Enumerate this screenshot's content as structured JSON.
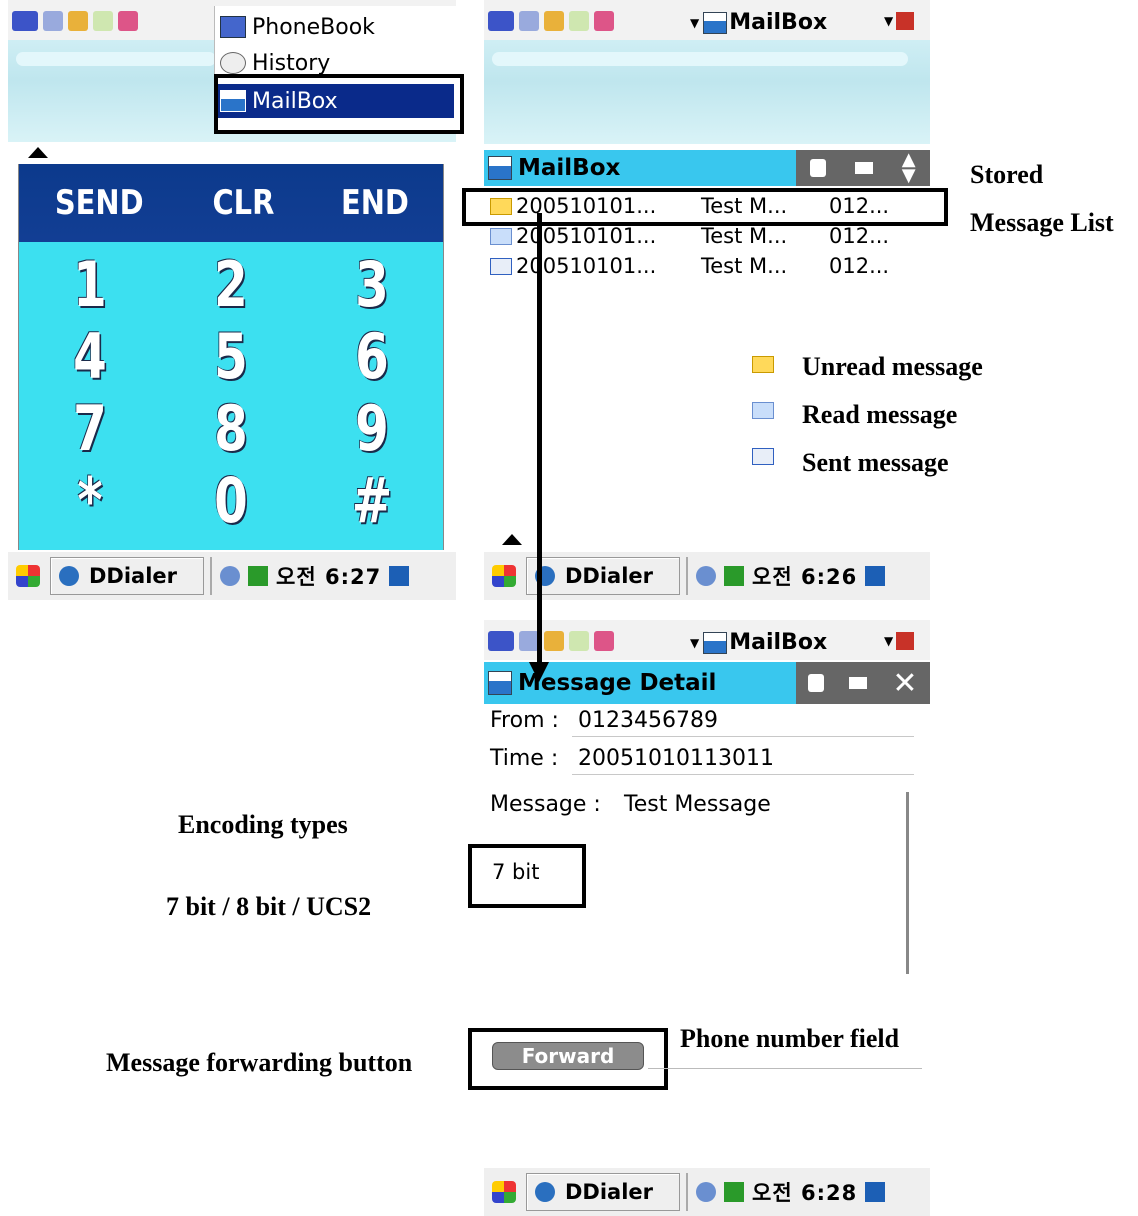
{
  "panel_left": {
    "menu": {
      "items": [
        {
          "label": "PhoneBook"
        },
        {
          "label": "History"
        },
        {
          "label": "MailBox"
        }
      ]
    },
    "keypad": {
      "top_keys": [
        "SEND",
        "CLR",
        "END"
      ],
      "rows": [
        [
          "1",
          "2",
          "3"
        ],
        [
          "4",
          "5",
          "6"
        ],
        [
          "7",
          "8",
          "9"
        ],
        [
          "*",
          "0",
          "#"
        ]
      ]
    },
    "taskbar": {
      "app": "DDialer",
      "time": "오전 6:27"
    }
  },
  "panel_mailbox": {
    "header": {
      "title": "MailBox"
    },
    "list_title": "MailBox",
    "messages": [
      {
        "type": "unread",
        "date": "200510101...",
        "text": "Test M...",
        "number": "012..."
      },
      {
        "type": "read",
        "date": "200510101...",
        "text": "Test M...",
        "number": "012..."
      },
      {
        "type": "sent",
        "date": "200510101...",
        "text": "Test M...",
        "number": "012..."
      }
    ],
    "taskbar": {
      "app": "DDialer",
      "time": "오전 6:26"
    }
  },
  "panel_detail": {
    "header": {
      "title": "MailBox"
    },
    "title": "Message Detail",
    "from_label": "From :",
    "from_value": "0123456789",
    "time_label": "Time :",
    "time_value": "20051010113011",
    "message_label": "Message :",
    "message_value": "Test Message",
    "encoding_value": "7 bit",
    "forward_label": "Forward",
    "taskbar": {
      "app": "DDialer",
      "time": "오전 6:28"
    }
  },
  "annotations": {
    "stored_line1": "Stored",
    "stored_line2": "Message List",
    "legend_unread": "Unread message",
    "legend_read": "Read message",
    "legend_sent": "Sent message",
    "encoding_title": "Encoding types",
    "encoding_options": "7 bit / 8 bit / UCS2",
    "forward_button_note": "Message forwarding button",
    "phone_field_note": "Phone number field"
  },
  "colors": {
    "keypad_bg": "#3ce0f0",
    "keypad_header": "#0c3a8c",
    "titlebar": "#39c7ee",
    "menu_selected": "#0a2a8a",
    "toolgroup": "#666666"
  }
}
